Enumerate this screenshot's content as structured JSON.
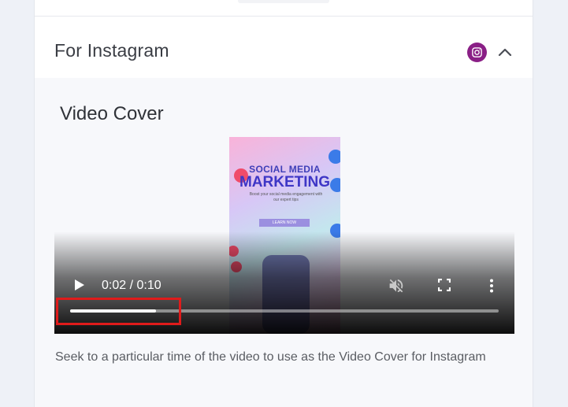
{
  "section": {
    "title": "For Instagram",
    "platform_icon": "instagram-icon",
    "toggle_icon": "chevron-up-icon"
  },
  "video_cover": {
    "title": "Video Cover",
    "poster": {
      "headline_top": "SOCIAL MEDIA",
      "headline_main": "MARKETING",
      "blurb": "Boost your social media engagement with our expert tips",
      "cta": "LEARN NOW"
    },
    "player": {
      "time": "0:02 / 0:10",
      "progress_fraction": 0.2,
      "play_icon": "play-icon",
      "mute_icon": "volume-muted-icon",
      "fullscreen_icon": "fullscreen-icon",
      "more_icon": "more-vertical-icon"
    },
    "caption": "Seek to a particular time of the video to use as the Video Cover for Instagram"
  },
  "colors": {
    "instagram_badge": "#8a1f86",
    "highlight": "#e01b1b",
    "page_bg": "#eef1f7"
  }
}
